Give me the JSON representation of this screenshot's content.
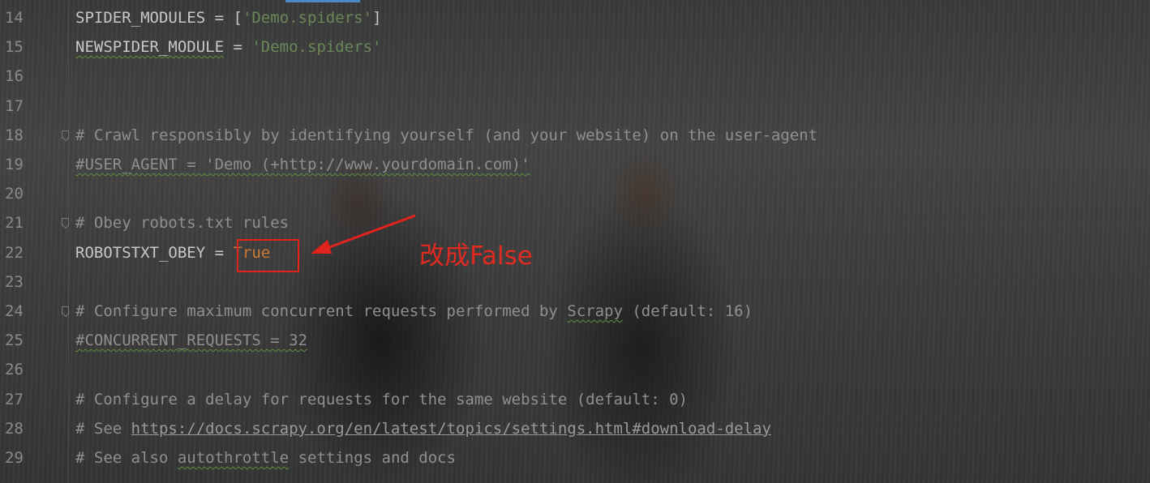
{
  "editor": {
    "lines": [
      {
        "num": "14",
        "segments": [
          {
            "text": "SPIDER_MODULES = [",
            "cls": ""
          },
          {
            "text": "'Demo.spiders'",
            "cls": "str"
          },
          {
            "text": "]",
            "cls": ""
          }
        ]
      },
      {
        "num": "15",
        "segments": [
          {
            "text": "NEWSPIDER_MODULE",
            "cls": "wavy"
          },
          {
            "text": " = ",
            "cls": ""
          },
          {
            "text": "'Demo.spiders'",
            "cls": "str"
          }
        ]
      },
      {
        "num": "16",
        "segments": []
      },
      {
        "num": "17",
        "segments": []
      },
      {
        "num": "18",
        "fold": true,
        "segments": [
          {
            "text": "# Crawl responsibly by identifying yourself (and your website) on the user-agent",
            "cls": "cmt"
          }
        ]
      },
      {
        "num": "19",
        "segments": [
          {
            "text": "#USER_AGENT = 'Demo (+http://www.yourdomain.com)'",
            "cls": "cmt wavy"
          }
        ]
      },
      {
        "num": "20",
        "segments": []
      },
      {
        "num": "21",
        "fold": true,
        "segments": [
          {
            "text": "# Obey robots.txt rules",
            "cls": "cmt"
          }
        ]
      },
      {
        "num": "22",
        "segments": [
          {
            "text": "ROBOTSTXT_OBEY = ",
            "cls": ""
          },
          {
            "text": "True",
            "cls": "kw"
          }
        ]
      },
      {
        "num": "23",
        "segments": []
      },
      {
        "num": "24",
        "fold": true,
        "segments": [
          {
            "text": "# Configure maximum concurrent requests performed by ",
            "cls": "cmt"
          },
          {
            "text": "Scrapy",
            "cls": "cmt wavy"
          },
          {
            "text": " (default: 16)",
            "cls": "cmt"
          }
        ]
      },
      {
        "num": "25",
        "segments": [
          {
            "text": "#CONCURRENT_REQUESTS = 32",
            "cls": "cmt wavy"
          }
        ]
      },
      {
        "num": "26",
        "segments": []
      },
      {
        "num": "27",
        "segments": [
          {
            "text": "# Configure a delay for requests for the same website (default: 0)",
            "cls": "cmt"
          }
        ]
      },
      {
        "num": "28",
        "segments": [
          {
            "text": "# See ",
            "cls": "cmt"
          },
          {
            "text": "https://docs.scrapy.org/en/latest/topics/settings.html#download-delay",
            "cls": "link"
          }
        ]
      },
      {
        "num": "29",
        "segments": [
          {
            "text": "# See also ",
            "cls": "cmt"
          },
          {
            "text": "autothrottle",
            "cls": "cmt wavy"
          },
          {
            "text": " settings and docs",
            "cls": "cmt"
          }
        ]
      }
    ]
  },
  "annotation": {
    "text": "改成False",
    "color": "#e02a22"
  },
  "colors": {
    "string": "#6a8759",
    "keyword": "#cc7832",
    "comment": "#8f8f8f",
    "annotation_red": "#e0231d"
  }
}
